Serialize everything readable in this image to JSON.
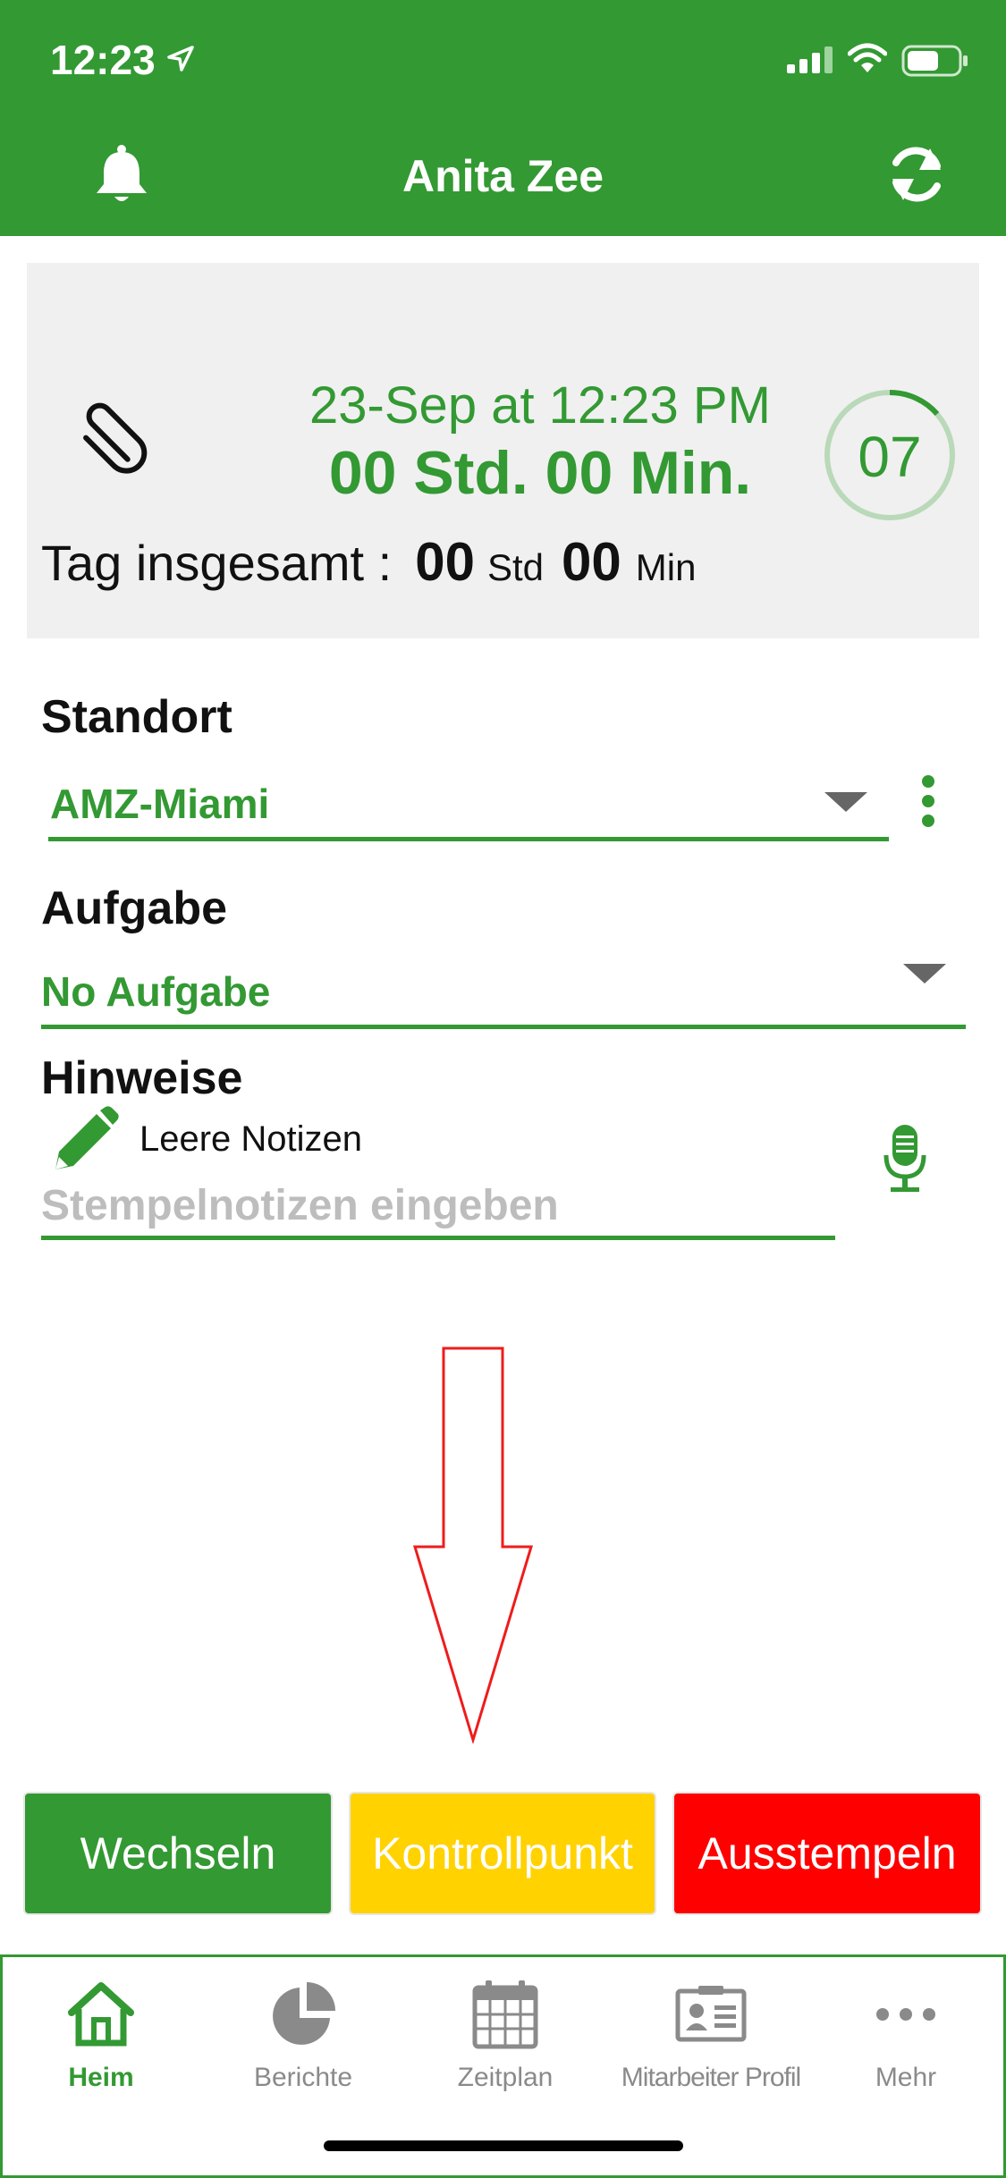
{
  "status_bar": {
    "time": "12:23"
  },
  "header": {
    "title": "Anita Zee"
  },
  "time_card": {
    "date_text": "23-Sep at 12:23 PM",
    "duration_text": "00 Std.  00 Min.",
    "ring_value": "07",
    "total_label": "Tag insgesamt :",
    "total_hours": "00",
    "hours_unit": "Std",
    "total_minutes": "00",
    "minutes_unit": "Min"
  },
  "form": {
    "location_label": "Standort",
    "location_value": "AMZ-Miami",
    "task_label": "Aufgabe",
    "task_value": "No Aufgabe",
    "notes_label": "Hinweise",
    "notes_empty_text": "Leere Notizen",
    "notes_placeholder": "Stempelnotizen eingeben"
  },
  "actions": {
    "switch_label": "Wechseln",
    "checkpoint_label": "Kontrollpunkt",
    "clock_out_label": "Ausstempeln"
  },
  "tabs": [
    {
      "label": "Heim",
      "icon": "home-icon",
      "active": true
    },
    {
      "label": "Berichte",
      "icon": "pie-chart-icon",
      "active": false
    },
    {
      "label": "Zeitplan",
      "icon": "calendar-icon",
      "active": false
    },
    {
      "label": "Mitarbeiter Profil",
      "icon": "id-card-icon",
      "active": false
    },
    {
      "label": "Mehr",
      "icon": "more-icon",
      "active": false
    }
  ],
  "colors": {
    "brand_green": "#339933",
    "checkpoint_yellow": "#ffd200",
    "clock_out_red": "#ff0000",
    "annotation_red": "#ee1c1c"
  }
}
